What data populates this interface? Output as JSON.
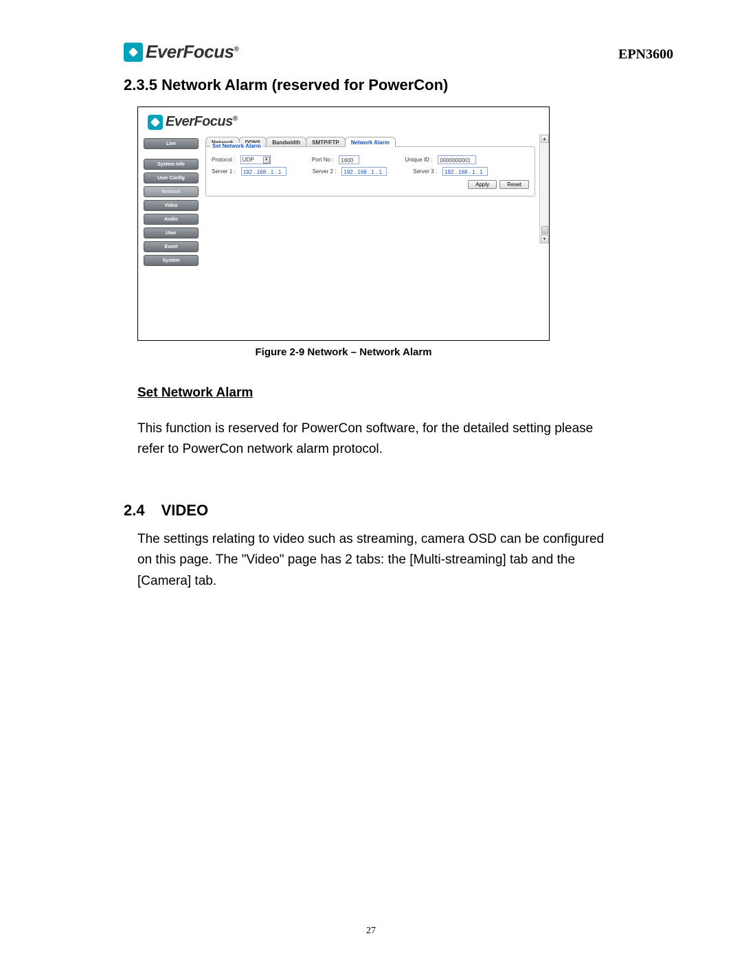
{
  "header": {
    "brand": "EverFocus",
    "model": "EPN3600"
  },
  "section235": {
    "number": "2.3.5",
    "title": "Network Alarm (reserved for PowerCon)"
  },
  "screenshot": {
    "brand": "EverFocus",
    "sidebar": [
      "Live",
      "System Info",
      "User Config",
      "Network",
      "Video",
      "Audio",
      "User",
      "Event",
      "System"
    ],
    "tabs": [
      "Network",
      "DDNS",
      "Bandwidth",
      "SMTP/FTP",
      "Network Alarm"
    ],
    "legend": "Set Network Alarm",
    "labels": {
      "protocol": "Protocol :",
      "portno": "Port No :",
      "uniqueid": "Unique ID :",
      "server1": "Server 1 :",
      "server2": "Server 2 :",
      "server3": "Server 3 :"
    },
    "values": {
      "protocol": "UDP",
      "portno": "1600",
      "uniqueid": "0000000001",
      "server1": "192 . 168 .  1  .  1",
      "server2": "192 . 168 .  1  .  1",
      "server3": "192 . 168 .  1  .  1"
    },
    "buttons": {
      "apply": "Apply",
      "reset": "Reset"
    }
  },
  "caption": "Figure 2-9 Network – Network Alarm",
  "subhead": "Set Network Alarm",
  "para1": "This function is reserved for PowerCon software, for the detailed setting please refer to PowerCon network alarm protocol.",
  "section24": {
    "number": "2.4",
    "title": "VIDEO"
  },
  "para2": "The settings relating to video such as streaming, camera OSD can be configured on this page.   The \"Video\" page has 2 tabs: the [Multi-streaming] tab and the [Camera] tab.",
  "pagenum": "27"
}
